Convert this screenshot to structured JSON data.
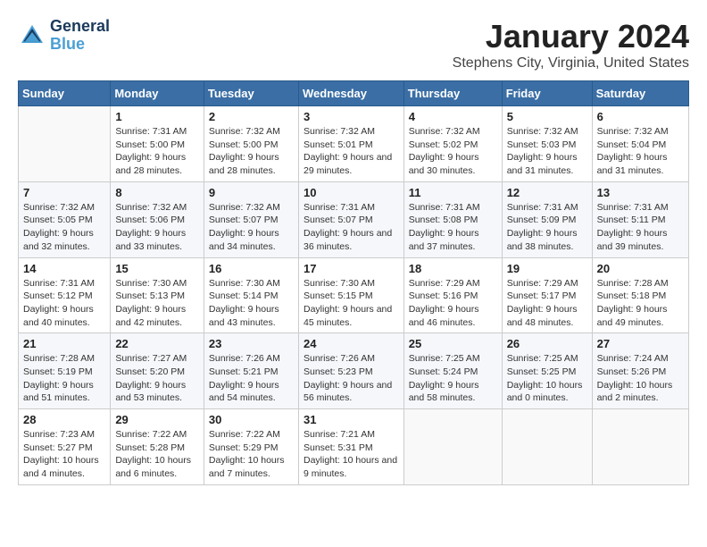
{
  "header": {
    "logo_line1": "General",
    "logo_line2": "Blue",
    "month": "January 2024",
    "location": "Stephens City, Virginia, United States"
  },
  "weekdays": [
    "Sunday",
    "Monday",
    "Tuesday",
    "Wednesday",
    "Thursday",
    "Friday",
    "Saturday"
  ],
  "weeks": [
    [
      {
        "day": "",
        "sunrise": "",
        "sunset": "",
        "daylight": ""
      },
      {
        "day": "1",
        "sunrise": "Sunrise: 7:31 AM",
        "sunset": "Sunset: 5:00 PM",
        "daylight": "Daylight: 9 hours and 28 minutes."
      },
      {
        "day": "2",
        "sunrise": "Sunrise: 7:32 AM",
        "sunset": "Sunset: 5:00 PM",
        "daylight": "Daylight: 9 hours and 28 minutes."
      },
      {
        "day": "3",
        "sunrise": "Sunrise: 7:32 AM",
        "sunset": "Sunset: 5:01 PM",
        "daylight": "Daylight: 9 hours and 29 minutes."
      },
      {
        "day": "4",
        "sunrise": "Sunrise: 7:32 AM",
        "sunset": "Sunset: 5:02 PM",
        "daylight": "Daylight: 9 hours and 30 minutes."
      },
      {
        "day": "5",
        "sunrise": "Sunrise: 7:32 AM",
        "sunset": "Sunset: 5:03 PM",
        "daylight": "Daylight: 9 hours and 31 minutes."
      },
      {
        "day": "6",
        "sunrise": "Sunrise: 7:32 AM",
        "sunset": "Sunset: 5:04 PM",
        "daylight": "Daylight: 9 hours and 31 minutes."
      }
    ],
    [
      {
        "day": "7",
        "sunrise": "Sunrise: 7:32 AM",
        "sunset": "Sunset: 5:05 PM",
        "daylight": "Daylight: 9 hours and 32 minutes."
      },
      {
        "day": "8",
        "sunrise": "Sunrise: 7:32 AM",
        "sunset": "Sunset: 5:06 PM",
        "daylight": "Daylight: 9 hours and 33 minutes."
      },
      {
        "day": "9",
        "sunrise": "Sunrise: 7:32 AM",
        "sunset": "Sunset: 5:07 PM",
        "daylight": "Daylight: 9 hours and 34 minutes."
      },
      {
        "day": "10",
        "sunrise": "Sunrise: 7:31 AM",
        "sunset": "Sunset: 5:07 PM",
        "daylight": "Daylight: 9 hours and 36 minutes."
      },
      {
        "day": "11",
        "sunrise": "Sunrise: 7:31 AM",
        "sunset": "Sunset: 5:08 PM",
        "daylight": "Daylight: 9 hours and 37 minutes."
      },
      {
        "day": "12",
        "sunrise": "Sunrise: 7:31 AM",
        "sunset": "Sunset: 5:09 PM",
        "daylight": "Daylight: 9 hours and 38 minutes."
      },
      {
        "day": "13",
        "sunrise": "Sunrise: 7:31 AM",
        "sunset": "Sunset: 5:11 PM",
        "daylight": "Daylight: 9 hours and 39 minutes."
      }
    ],
    [
      {
        "day": "14",
        "sunrise": "Sunrise: 7:31 AM",
        "sunset": "Sunset: 5:12 PM",
        "daylight": "Daylight: 9 hours and 40 minutes."
      },
      {
        "day": "15",
        "sunrise": "Sunrise: 7:30 AM",
        "sunset": "Sunset: 5:13 PM",
        "daylight": "Daylight: 9 hours and 42 minutes."
      },
      {
        "day": "16",
        "sunrise": "Sunrise: 7:30 AM",
        "sunset": "Sunset: 5:14 PM",
        "daylight": "Daylight: 9 hours and 43 minutes."
      },
      {
        "day": "17",
        "sunrise": "Sunrise: 7:30 AM",
        "sunset": "Sunset: 5:15 PM",
        "daylight": "Daylight: 9 hours and 45 minutes."
      },
      {
        "day": "18",
        "sunrise": "Sunrise: 7:29 AM",
        "sunset": "Sunset: 5:16 PM",
        "daylight": "Daylight: 9 hours and 46 minutes."
      },
      {
        "day": "19",
        "sunrise": "Sunrise: 7:29 AM",
        "sunset": "Sunset: 5:17 PM",
        "daylight": "Daylight: 9 hours and 48 minutes."
      },
      {
        "day": "20",
        "sunrise": "Sunrise: 7:28 AM",
        "sunset": "Sunset: 5:18 PM",
        "daylight": "Daylight: 9 hours and 49 minutes."
      }
    ],
    [
      {
        "day": "21",
        "sunrise": "Sunrise: 7:28 AM",
        "sunset": "Sunset: 5:19 PM",
        "daylight": "Daylight: 9 hours and 51 minutes."
      },
      {
        "day": "22",
        "sunrise": "Sunrise: 7:27 AM",
        "sunset": "Sunset: 5:20 PM",
        "daylight": "Daylight: 9 hours and 53 minutes."
      },
      {
        "day": "23",
        "sunrise": "Sunrise: 7:26 AM",
        "sunset": "Sunset: 5:21 PM",
        "daylight": "Daylight: 9 hours and 54 minutes."
      },
      {
        "day": "24",
        "sunrise": "Sunrise: 7:26 AM",
        "sunset": "Sunset: 5:23 PM",
        "daylight": "Daylight: 9 hours and 56 minutes."
      },
      {
        "day": "25",
        "sunrise": "Sunrise: 7:25 AM",
        "sunset": "Sunset: 5:24 PM",
        "daylight": "Daylight: 9 hours and 58 minutes."
      },
      {
        "day": "26",
        "sunrise": "Sunrise: 7:25 AM",
        "sunset": "Sunset: 5:25 PM",
        "daylight": "Daylight: 10 hours and 0 minutes."
      },
      {
        "day": "27",
        "sunrise": "Sunrise: 7:24 AM",
        "sunset": "Sunset: 5:26 PM",
        "daylight": "Daylight: 10 hours and 2 minutes."
      }
    ],
    [
      {
        "day": "28",
        "sunrise": "Sunrise: 7:23 AM",
        "sunset": "Sunset: 5:27 PM",
        "daylight": "Daylight: 10 hours and 4 minutes."
      },
      {
        "day": "29",
        "sunrise": "Sunrise: 7:22 AM",
        "sunset": "Sunset: 5:28 PM",
        "daylight": "Daylight: 10 hours and 6 minutes."
      },
      {
        "day": "30",
        "sunrise": "Sunrise: 7:22 AM",
        "sunset": "Sunset: 5:29 PM",
        "daylight": "Daylight: 10 hours and 7 minutes."
      },
      {
        "day": "31",
        "sunrise": "Sunrise: 7:21 AM",
        "sunset": "Sunset: 5:31 PM",
        "daylight": "Daylight: 10 hours and 9 minutes."
      },
      {
        "day": "",
        "sunrise": "",
        "sunset": "",
        "daylight": ""
      },
      {
        "day": "",
        "sunrise": "",
        "sunset": "",
        "daylight": ""
      },
      {
        "day": "",
        "sunrise": "",
        "sunset": "",
        "daylight": ""
      }
    ]
  ]
}
